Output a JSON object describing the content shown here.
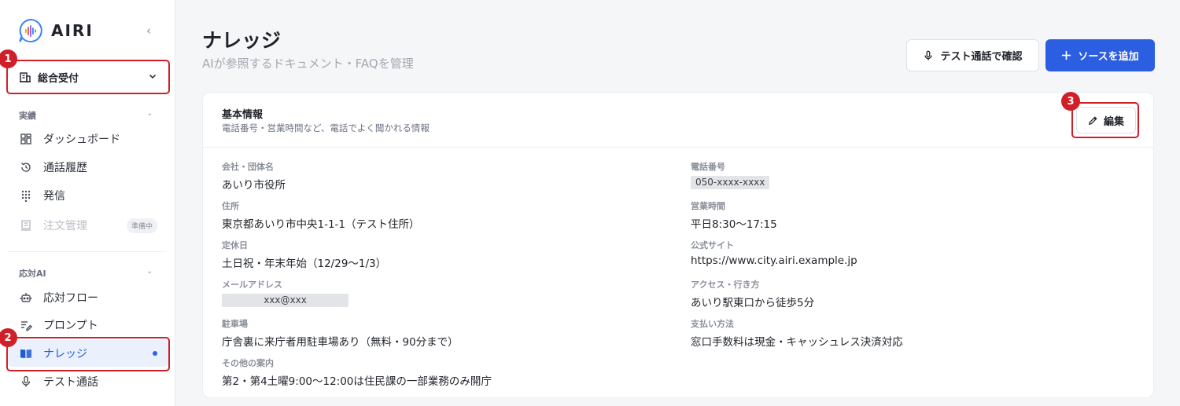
{
  "app": {
    "logo_text": "AIRI"
  },
  "sidebar": {
    "workspace": "総合受付",
    "section_results": "実績",
    "section_ai": "応対AI",
    "items": [
      {
        "label": "ダッシュボード",
        "icon": "dashboard-icon"
      },
      {
        "label": "通話履歴",
        "icon": "history-icon"
      },
      {
        "label": "発信",
        "icon": "dialpad-icon"
      },
      {
        "label": "注文管理",
        "icon": "order-icon",
        "badge": "準備中",
        "disabled": true
      },
      {
        "label": "応対フロー",
        "icon": "bot-icon"
      },
      {
        "label": "プロンプト",
        "icon": "prompt-icon"
      },
      {
        "label": "ナレッジ",
        "icon": "book-icon",
        "active": true
      },
      {
        "label": "テスト通話",
        "icon": "mic-icon"
      }
    ]
  },
  "markers": {
    "m1": "1",
    "m2": "2",
    "m3": "3"
  },
  "header": {
    "title": "ナレッジ",
    "subtitle": "AIが参照するドキュメント・FAQを管理",
    "test_call_button": "テスト通話で確認",
    "add_source_button": "ソースを追加"
  },
  "card": {
    "title": "基本情報",
    "description": "電話番号・営業時間など、電話でよく聞かれる情報",
    "edit_button": "編集",
    "fields": {
      "org_name": {
        "label": "会社・団体名",
        "value": "あいり市役所"
      },
      "phone": {
        "label": "電話番号",
        "value": "050-xxxx-xxxx"
      },
      "address": {
        "label": "住所",
        "value": "東京都あいり市中央1-1-1（テスト住所）"
      },
      "hours": {
        "label": "営業時間",
        "value": "平日8:30〜17:15"
      },
      "holidays": {
        "label": "定休日",
        "value": "土日祝・年末年始（12/29〜1/3）"
      },
      "website": {
        "label": "公式サイト",
        "value": "https://www.city.airi.example.jp"
      },
      "email": {
        "label": "メールアドレス",
        "value": "xxx@xxx"
      },
      "access": {
        "label": "アクセス・行き方",
        "value": "あいり駅東口から徒歩5分"
      },
      "parking": {
        "label": "駐車場",
        "value": "庁舎裏に来庁者用駐車場あり（無料・90分まで）"
      },
      "payment": {
        "label": "支払い方法",
        "value": "窓口手数料は現金・キャッシュレス決済対応"
      },
      "other": {
        "label": "その他の案内",
        "value": "第2・第4土曜9:00〜12:00は住民課の一部業務のみ開庁"
      }
    }
  },
  "colors": {
    "accent": "#2b5ee0",
    "highlight": "#d11f2a",
    "active_bg": "#eaf1fd"
  }
}
